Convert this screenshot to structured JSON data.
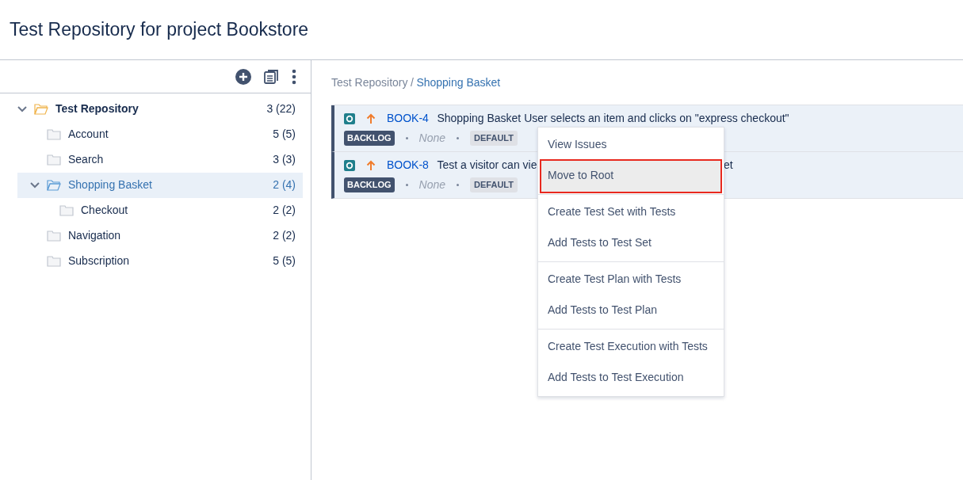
{
  "page_title": "Test Repository for project Bookstore",
  "tree": [
    {
      "label": "Test Repository",
      "count": "3 (22)",
      "expanded": true,
      "selected": false,
      "children": [
        {
          "label": "Account",
          "count": "5 (5)",
          "selected": false
        },
        {
          "label": "Search",
          "count": "3 (3)",
          "selected": false
        },
        {
          "label": "Shopping Basket",
          "count": "2 (4)",
          "expanded": true,
          "selected": true,
          "children": [
            {
              "label": "Checkout",
              "count": "2 (2)",
              "selected": false
            }
          ]
        },
        {
          "label": "Navigation",
          "count": "2 (2)",
          "selected": false
        },
        {
          "label": "Subscription",
          "count": "5 (5)",
          "selected": false
        }
      ]
    }
  ],
  "breadcrumb": [
    {
      "label": "Test Repository",
      "current": false
    },
    {
      "label": "Shopping Basket",
      "current": true
    }
  ],
  "breadcrumb_separator": "/",
  "tests": [
    {
      "key": "BOOK-4",
      "summary": "Shopping Basket User selects an item and clicks on \"express checkout\"",
      "status": "BACKLOG",
      "assignee": "None",
      "environment": "DEFAULT"
    },
    {
      "key": "BOOK-8",
      "summary": "Test a visitor can vie",
      "summary_tail": "et",
      "status": "BACKLOG",
      "assignee": "None",
      "environment": "DEFAULT"
    }
  ],
  "context_menu": [
    [
      {
        "label": "View Issues",
        "selected": false
      },
      {
        "label": "Move to Root",
        "selected": true
      }
    ],
    [
      {
        "label": "Create Test Set with Tests",
        "selected": false
      },
      {
        "label": "Add Tests to Test Set",
        "selected": false
      }
    ],
    [
      {
        "label": "Create Test Plan with Tests",
        "selected": false
      },
      {
        "label": "Add Tests to Test Plan",
        "selected": false
      }
    ],
    [
      {
        "label": "Create Test Execution with Tests",
        "selected": false
      },
      {
        "label": "Add Tests to Test Execution",
        "selected": false
      }
    ]
  ]
}
